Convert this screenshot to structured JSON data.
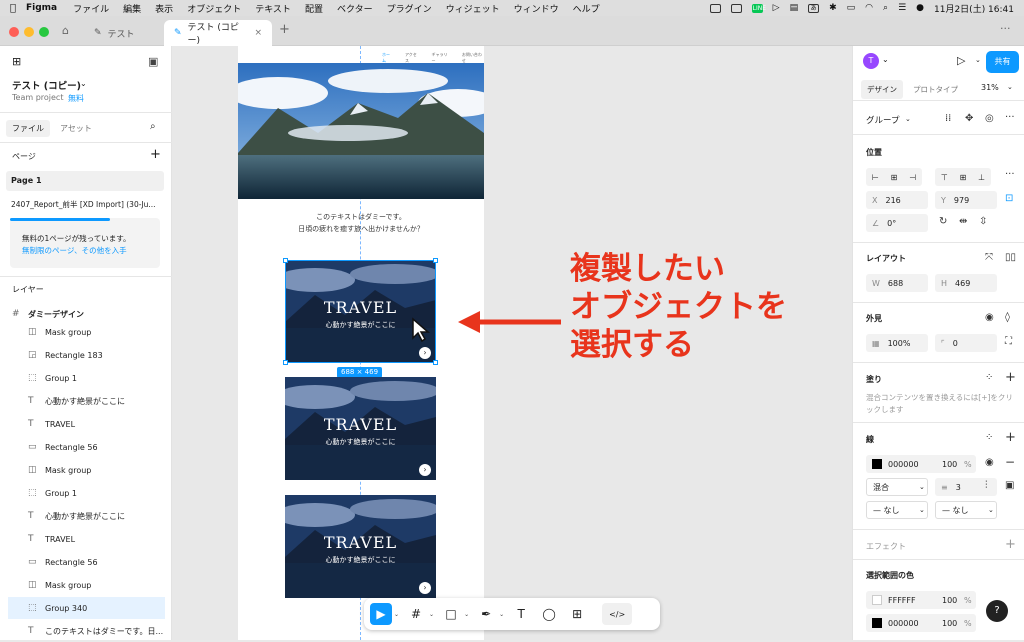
{
  "menubar": {
    "apple": "",
    "app": "Figma",
    "items": [
      "ファイル",
      "編集",
      "表示",
      "オブジェクト",
      "テキスト",
      "配置",
      "ベクター",
      "プラグイン",
      "ウィジェット",
      "ウィンドウ",
      "ヘルプ"
    ],
    "clock": "11月2日(土)  16:41",
    "line": "LINE",
    "ime": "あ"
  },
  "tabs": {
    "t1": "テスト",
    "t2": "テスト (コピー)",
    "close": "×",
    "add": "+",
    "more": "···"
  },
  "left": {
    "file_title": "テスト (コピー)",
    "team": "Team project",
    "plan": "無料",
    "tab_file": "ファイル",
    "tab_assets": "アセット",
    "pages_label": "ページ",
    "add": "+",
    "page1": "Page 1",
    "page2": "2407_Report_前半 [XD Import] (30-Ju...",
    "promo_text": "無料の1ページが残っています。",
    "promo_link": "無制限のページ、その他を入手",
    "layers_label": "レイヤー",
    "layers": [
      "ダミーデザイン",
      "Mask group",
      "Rectangle 183",
      "Group 1",
      "心動かす絶景がここに",
      "TRAVEL",
      "Rectangle 56",
      "Mask group",
      "Group 1",
      "心動かす絶景がここに",
      "TRAVEL",
      "Rectangle 56",
      "Mask group",
      "Group 340",
      "このテキストはダミーです。日..."
    ]
  },
  "canvas": {
    "nav": [
      "ホーム",
      "アクセス",
      "ギャラリー",
      "お問い合わせ"
    ],
    "body1": "このテキストはダミーです。",
    "body2": "日頃の疲れを癒す旅へ出かけませんか？",
    "card_title": "TRAVEL",
    "card_sub": "心動かす絶景がここに",
    "size_badge": "688 × 469",
    "annotation": [
      "複製したい",
      "オブジェクトを",
      "選択する"
    ]
  },
  "right": {
    "avatar": "T",
    "share": "共有",
    "tab_design": "デザイン",
    "tab_proto": "プロトタイプ",
    "zoom": "31%",
    "group": "グループ",
    "pos_label": "位置",
    "x_k": "X",
    "x": "216",
    "y_k": "Y",
    "y": "979",
    "rot_k": "∠",
    "rot": "0°",
    "layout_label": "レイアウト",
    "w_k": "W",
    "w": "688",
    "h_k": "H",
    "h": "469",
    "appearance_label": "外見",
    "opacity": "100%",
    "radius_k": "⌜",
    "radius": "0",
    "fill_label": "塗り",
    "fill_hint": "混合コンテンツを置き換えるには[+]をクリックします",
    "stroke_label": "線",
    "stroke_hex": "000000",
    "stroke_op": "100",
    "pct": "%",
    "stroke_mode": "混合",
    "stroke_w": "3",
    "none1": "— なし",
    "none2": "— なし",
    "effect_label": "エフェクト",
    "sel_colors_label": "選択範囲の色",
    "c1_hex": "FFFFFF",
    "c1_op": "100",
    "c2_hex": "000000",
    "c2_op": "100",
    "help": "?"
  },
  "toolbar": {
    "move": "▶",
    "frame": "#",
    "rect": "□",
    "pen": "✒",
    "text": "T",
    "comment": "◯",
    "actions": "⊞",
    "code": "</>"
  },
  "colors": {
    "accent": "#0d99ff",
    "annotation": "#e8341c",
    "selection": "#0d99ff"
  }
}
